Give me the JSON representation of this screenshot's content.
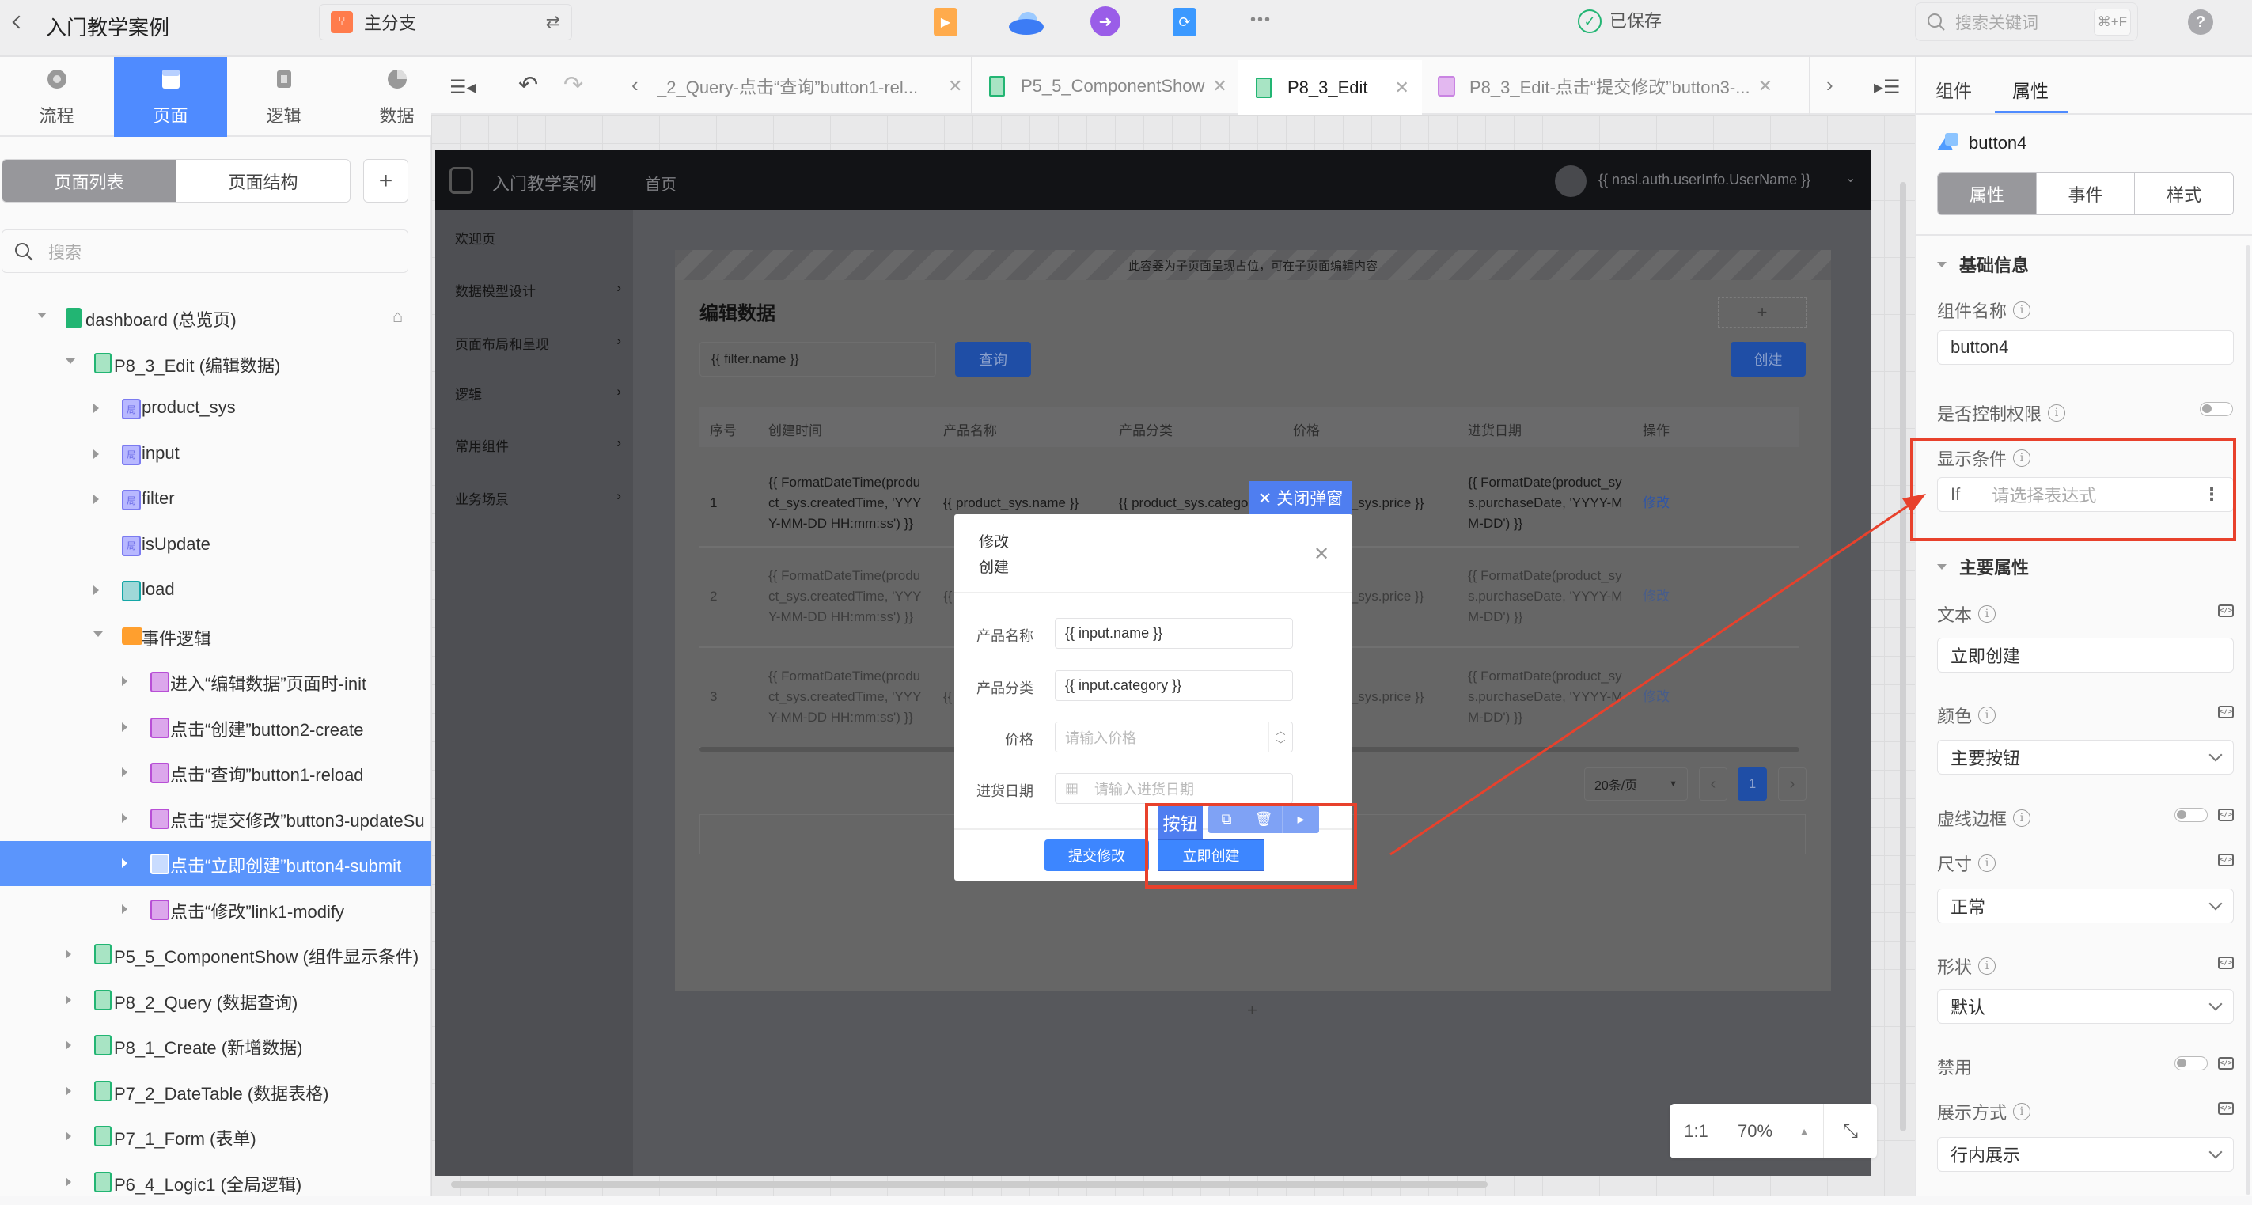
{
  "topbar": {
    "project_title": "入门教学案例",
    "branch": "主分支",
    "save_status": "已保存",
    "search_placeholder": "搜索关键词",
    "search_shortcut": "⌘+F",
    "help": "?",
    "more": "•••"
  },
  "nav_tabs": [
    {
      "label": "流程",
      "icon": "flow-icon"
    },
    {
      "label": "页面",
      "icon": "page-icon",
      "active": true
    },
    {
      "label": "逻辑",
      "icon": "logic-chip-icon"
    },
    {
      "label": "数据",
      "icon": "pie-chart-icon"
    }
  ],
  "left_panel": {
    "segments": [
      "页面列表",
      "页面结构"
    ],
    "add": "+",
    "search_placeholder": "搜索",
    "tree": [
      {
        "label": "dashboard (总览页)",
        "level": 0,
        "icon": "page-solid",
        "state": "expanded",
        "home": true
      },
      {
        "label": "P8_3_Edit (编辑数据)",
        "level": 1,
        "icon": "page",
        "state": "expanded"
      },
      {
        "label": "product_sys",
        "level": 2,
        "icon": "local-var",
        "state": "collapsed"
      },
      {
        "label": "input",
        "level": 2,
        "icon": "local-var",
        "state": "collapsed"
      },
      {
        "label": "filter",
        "level": 2,
        "icon": "local-var",
        "state": "collapsed"
      },
      {
        "label": "isUpdate",
        "level": 2,
        "icon": "local-var",
        "state": "none"
      },
      {
        "label": "load",
        "level": 2,
        "icon": "logic-teal",
        "state": "collapsed"
      },
      {
        "label": "事件逻辑",
        "level": 2,
        "icon": "folder",
        "state": "expanded"
      },
      {
        "label": "进入“编辑数据”页面时-init",
        "level": 3,
        "icon": "logic-purple",
        "state": "collapsed"
      },
      {
        "label": "点击“创建”button2-create",
        "level": 3,
        "icon": "logic-purple",
        "state": "collapsed"
      },
      {
        "label": "点击“查询”button1-reload",
        "level": 3,
        "icon": "logic-purple",
        "state": "collapsed"
      },
      {
        "label": "点击“提交修改”button3-updateSu",
        "level": 3,
        "icon": "logic-purple",
        "state": "collapsed"
      },
      {
        "label": "点击“立即创建”button4-submit",
        "level": 3,
        "icon": "logic-purple",
        "state": "collapsed",
        "selected": true
      },
      {
        "label": "点击“修改”link1-modify",
        "level": 3,
        "icon": "logic-purple",
        "state": "collapsed"
      },
      {
        "label": "P5_5_ComponentShow (组件显示条件)",
        "level": 1,
        "icon": "page",
        "state": "collapsed"
      },
      {
        "label": "P8_2_Query (数据查询)",
        "level": 1,
        "icon": "page",
        "state": "collapsed"
      },
      {
        "label": "P8_1_Create (新增数据)",
        "level": 1,
        "icon": "page",
        "state": "collapsed"
      },
      {
        "label": "P7_2_DateTable (数据表格)",
        "level": 1,
        "icon": "page",
        "state": "collapsed"
      },
      {
        "label": "P7_1_Form (表单)",
        "level": 1,
        "icon": "page",
        "state": "collapsed"
      },
      {
        "label": "P6_4_Logic1 (全局逻辑)",
        "level": 1,
        "icon": "page",
        "state": "collapsed"
      }
    ]
  },
  "editor_tabs": [
    {
      "label": "_2_Query-点击“查询”button1-rel...",
      "icon": "none"
    },
    {
      "label": "P5_5_ComponentShow",
      "icon": "page"
    },
    {
      "label": "P8_3_Edit",
      "icon": "page",
      "active": true
    },
    {
      "label": "P8_3_Edit-点击“提交修改”button3-...",
      "icon": "logic"
    }
  ],
  "preview": {
    "app_title": "入门教学案例",
    "home_link": "首页",
    "username": "{{ nasl.auth.userInfo.UserName }}",
    "sidebar": [
      "欢迎页",
      "数据模型设计",
      "页面布局和呈现",
      "逻辑",
      "常用组件",
      "业务场景"
    ],
    "placeholder_note": "此容器为子页面呈现占位，可在子页面编辑内容",
    "page_title": "编辑数据",
    "add": "+",
    "filter_value": "{{ filter.name }}",
    "query_button": "查询",
    "create_button": "创建",
    "table": {
      "headers": [
        "序号",
        "创建时间",
        "产品名称",
        "产品分类",
        "价格",
        "进货日期",
        "操作"
      ],
      "rows": [
        [
          "1",
          "{{ FormatDateTime(product_sys.createdTime, 'YYYY-MM-DD HH:mm:ss') }}",
          "{{ product_sys.name }}",
          "{{ product_sys.category }}",
          "{{ product_sys.price }}",
          "{{ FormatDate(product_sys.purchaseDate, 'YYYY-MM-DD') }}",
          "修改"
        ],
        [
          "2",
          "{{ FormatDateTime(product_sys.createdTime, 'YYYY-MM-DD HH:mm:ss') }}",
          "{{ product_sys.name }}",
          "{{ product_sys.category }}",
          "{{ product_sys.price }}",
          "{{ FormatDate(product_sys.purchaseDate, 'YYYY-MM-DD') }}",
          "修改"
        ],
        [
          "3",
          "{{ FormatDateTime(product_sys.createdTime, 'YYYY-MM-DD HH:mm:ss') }}",
          "{{ product_sys.name }}",
          "{{ product_sys.category }}",
          "{{ product_sys.price }}",
          "{{ FormatDate(product_sys.purchaseDate, 'YYYY-MM-DD') }}",
          "修改"
        ]
      ]
    },
    "pagination": {
      "page_size": "20条/页",
      "prev": "‹",
      "current": "1",
      "next": "›"
    },
    "bottom_add": "+"
  },
  "close_modal_tag": "✕ 关闭弹窗",
  "modal": {
    "title_lines": [
      "修改",
      "创建"
    ],
    "close": "✕",
    "fields": [
      {
        "label": "产品名称",
        "value": "{{ input.name }}",
        "placeholder": ""
      },
      {
        "label": "产品分类",
        "value": "{{ input.category }}",
        "placeholder": ""
      },
      {
        "label": "价格",
        "value": "",
        "placeholder": "请输入价格"
      },
      {
        "label": "进货日期",
        "value": "",
        "placeholder": "请输入进货日期"
      }
    ],
    "submit_edit": "提交修改",
    "submit_create": "立即创建"
  },
  "selection_toolbar": {
    "type_label": "按钮",
    "actions": [
      "duplicate-icon",
      "delete-icon",
      "play-icon"
    ]
  },
  "zoom_control": {
    "reset": "1:1",
    "level": "70%"
  },
  "right_panel": {
    "tabs": [
      "组件",
      "属性"
    ],
    "active_tab": "属性",
    "component_name": "button4",
    "segments": [
      "属性",
      "事件",
      "样式"
    ],
    "sections": {
      "basic": "基础信息",
      "main": "主要属性"
    },
    "name_label": "组件名称",
    "name_value": "button4",
    "permission_label": "是否控制权限",
    "permission_on": false,
    "display_label": "显示条件",
    "display_prefix": "If",
    "display_placeholder": "请选择表达式",
    "text_label": "文本",
    "text_value": "立即创建",
    "color_label": "颜色",
    "color_value": "主要按钮",
    "dashed_label": "虚线边框",
    "dashed_on": false,
    "size_label": "尺寸",
    "size_value": "正常",
    "shape_label": "形状",
    "shape_value": "默认",
    "disabled_label": "禁用",
    "disabled_on": false,
    "display_mode_label": "展示方式",
    "display_mode_value": "行内展示"
  },
  "colors": {
    "accent": "#4f8bff",
    "annotation_red": "#e8412c",
    "page_icon_green": "#22b573",
    "logic_purple": "#b84fd6"
  }
}
